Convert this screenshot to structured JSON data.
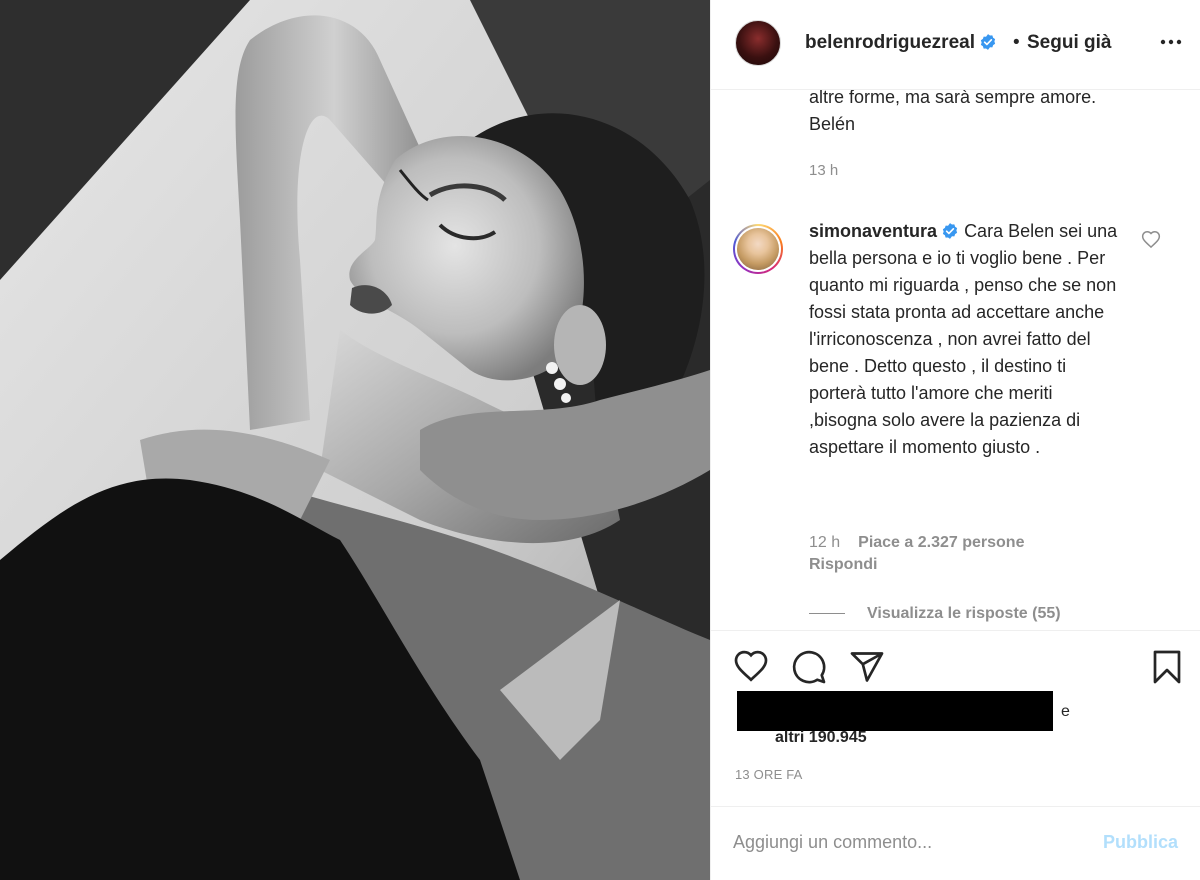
{
  "header": {
    "username": "belenrodriguezreal",
    "separator": "•",
    "follow_label": "Segui già"
  },
  "caption": {
    "tail_line_1": "altre forme, ma sarà sempre amore.",
    "tail_line_2": "Belén",
    "time": "13 h"
  },
  "comment": {
    "username": "simonaventura",
    "text": "Cara Belen sei una bella persona e io ti voglio bene . Per quanto mi riguarda , penso che se non fossi stata pronta ad accettare anche l'irriconoscenza , non avrei fatto del bene . Detto questo , il destino ti porterà tutto l'amore che meriti ,bisogna solo avere la pazienza di aspettare il momento giusto .",
    "time": "12 h",
    "likes": "Piace a 2.327 persone",
    "reply_label": "Rispondi",
    "view_replies": "Visualizza le risposte (55)"
  },
  "actions": {
    "icons": [
      "heart-icon",
      "comment-icon",
      "share-icon",
      "bookmark-icon"
    ]
  },
  "likes": {
    "conjunction": "e",
    "others": "altri 190.945"
  },
  "post_time": "13 ORE FA",
  "add_comment": {
    "placeholder": "Aggiungi un commento...",
    "publish_label": "Pubblica"
  },
  "colors": {
    "verified": "#3897f0",
    "muted_text": "#8e8e8e",
    "publish_disabled": "#b2dffc"
  }
}
